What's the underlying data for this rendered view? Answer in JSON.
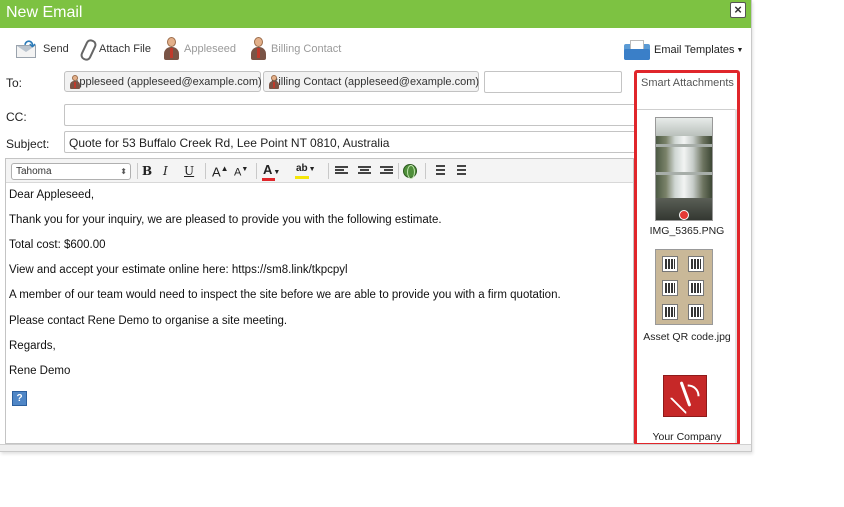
{
  "window": {
    "title": "New Email",
    "close_label": "×"
  },
  "toolbar": {
    "send_label": "Send",
    "attach_label": "Attach File",
    "contact1_label": "Appleseed",
    "contact2_label": "Billing Contact",
    "templates_label": "Email Templates"
  },
  "fields": {
    "to_label": "To:",
    "cc_label": "CC:",
    "subject_label": "Subject:",
    "to_recipients": [
      {
        "label": "Appleseed (appleseed@example.com)"
      },
      {
        "label": "Billing Contact (appleseed@example.com)"
      }
    ],
    "to_input_value": "",
    "cc_value": "",
    "subject_value": "Quote for 53 Buffalo Creek Rd, Lee Point NT 0810, Australia"
  },
  "editor": {
    "font_name": "Tahoma",
    "bold_label": "B",
    "italic_label": "I",
    "underline_label": "U",
    "grow_label": "A",
    "shrink_label": "A",
    "font_color_label": "A",
    "highlight_label": "ab",
    "font_color": "#e0262b",
    "highlight_color": "#f5e60a",
    "help_label": "?",
    "body": [
      "Dear Appleseed,",
      "Thank you for your inquiry, we are pleased to provide you with the following estimate.",
      "Total cost: $600.00",
      "View and accept your estimate online here: https://sm8.link/tkpcpyl",
      "A member of our team would need to inspect the site before we are able to provide you with a firm quotation.",
      "Please contact Rene Demo to organise a site meeting.",
      "Regards,",
      "Rene Demo"
    ]
  },
  "smart_attachments": {
    "title": "Smart Attachments",
    "highlight_color": "#e0262b",
    "items": [
      {
        "name": "IMG_5365.PNG",
        "icon": "photo-thumbnail"
      },
      {
        "name": "Asset QR code.jpg",
        "icon": "photo-thumbnail"
      },
      {
        "name": "Your Company",
        "icon": "pdf-icon"
      }
    ]
  },
  "colors": {
    "title_bar": "#7dc242"
  }
}
